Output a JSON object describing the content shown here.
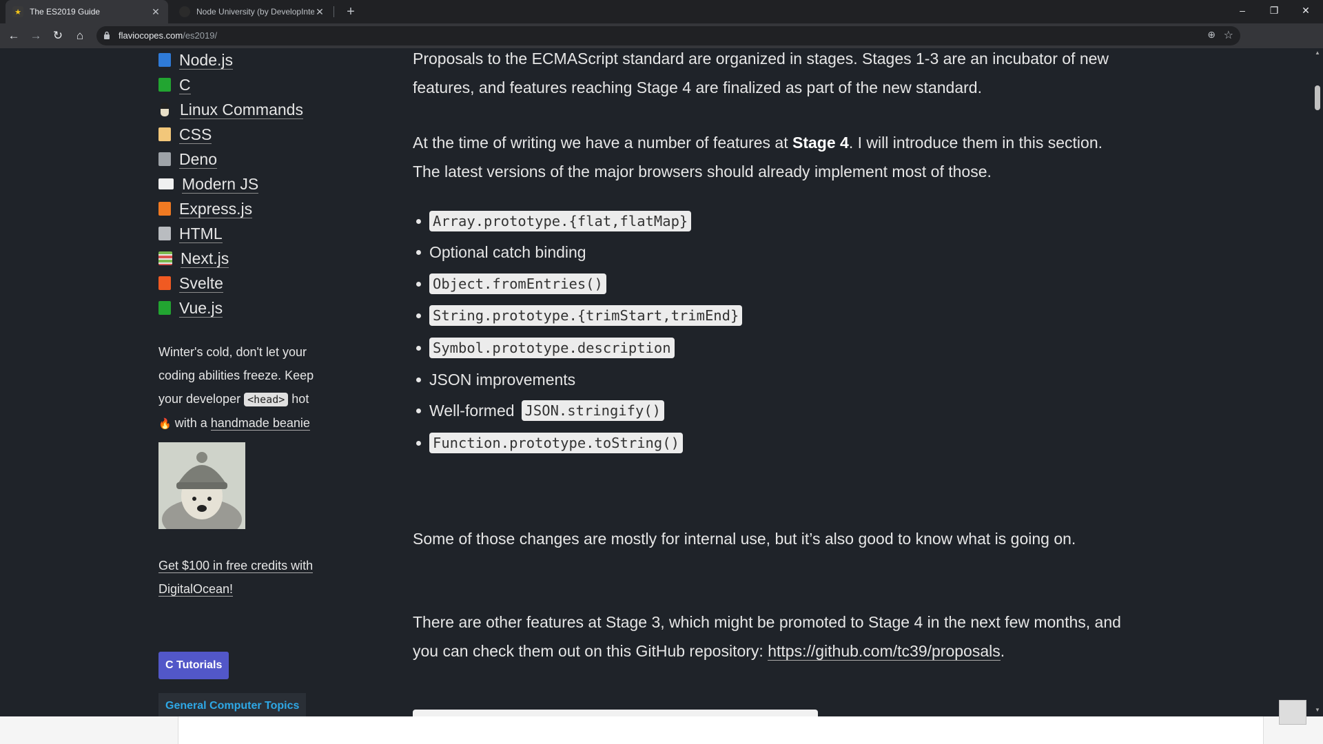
{
  "browser": {
    "tabs": [
      {
        "title": "The ES2019 Guide",
        "active": true
      },
      {
        "title": "Node University (by DevelopInte",
        "active": false
      }
    ],
    "new_tab": "+",
    "url_host": "flaviocopes.com",
    "url_path": "/es2019/",
    "window_controls": {
      "minimize": "–",
      "restore": "❐",
      "close": "✕"
    }
  },
  "sidebar": {
    "items": [
      {
        "label": "Node.js",
        "color": "#2f7bd8"
      },
      {
        "label": "C",
        "color": "#22a531"
      },
      {
        "label": "Linux Commands",
        "color": "#e8e0c8"
      },
      {
        "label": "CSS",
        "color": "#f2c77a"
      },
      {
        "label": "Deno",
        "color": "#9ea3a8"
      },
      {
        "label": "Modern JS",
        "color": "#f0f0f0"
      },
      {
        "label": "Express.js",
        "color": "#f07a22"
      },
      {
        "label": "HTML",
        "color": "#b9bcc0"
      },
      {
        "label": "Next.js",
        "color": "#7ab94f"
      },
      {
        "label": "Svelte",
        "color": "#f05a22"
      },
      {
        "label": "Vue.js",
        "color": "#22a531"
      }
    ],
    "promo": {
      "text_1": "Winter's cold, don't let your coding abilities freeze. Keep your developer",
      "code": "<head>",
      "text_2": "hot",
      "fire": "🔥",
      "text_3": "with a",
      "link": "handmade beanie"
    },
    "digitalocean": "Get $100 in free credits with DigitalOcean!",
    "tutorials_button": "C Tutorials",
    "general_topics": "General Computer Topics"
  },
  "article": {
    "p1": "Proposals to the ECMAScript standard are organized in stages. Stages 1-3 are an incubator of new features, and features reaching Stage 4 are finalized as part of the new standard.",
    "p2_before": "At the time of writing we have a number of features at ",
    "p2_bold": "Stage 4",
    "p2_after": ". I will introduce them in this section. The latest versions of the major browsers should already implement most of those.",
    "bullets": [
      {
        "code": "Array.prototype.{flat,flatMap}",
        "text": ""
      },
      {
        "code": "",
        "text": "Optional catch binding"
      },
      {
        "code": "Object.fromEntries()",
        "text": ""
      },
      {
        "code": "String.prototype.{trimStart,trimEnd}",
        "text": ""
      },
      {
        "code": "Symbol.prototype.description",
        "text": ""
      },
      {
        "code": "",
        "text": "JSON improvements"
      },
      {
        "code": "JSON.stringify()",
        "text": "Well-formed"
      },
      {
        "code": "Function.prototype.toString()",
        "text": ""
      }
    ],
    "p3": "Some of those changes are mostly for internal use, but it’s also good to know what is going on.",
    "p4_text": "There are other features at Stage 3, which might be promoted to Stage 4 in the next few months, and you can check them out on this GitHub repository: ",
    "p4_link": "https://github.com/tc39/proposals",
    "p4_end": "."
  }
}
